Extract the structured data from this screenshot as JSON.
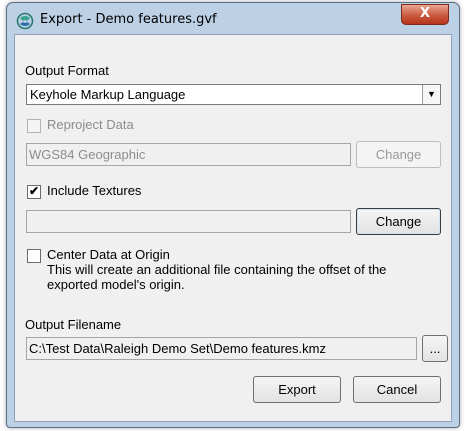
{
  "window": {
    "title": "Export - Demo features.gvf",
    "close_label": "X"
  },
  "output_format": {
    "label": "Output Format",
    "selected": "Keyhole Markup Language"
  },
  "reproject": {
    "label": "Reproject Data",
    "checked": false,
    "projection_value": "WGS84 Geographic",
    "change_label": "Change"
  },
  "textures": {
    "label": "Include Textures",
    "checked": true,
    "path_value": "",
    "change_label": "Change"
  },
  "center": {
    "label": "Center Data at Origin",
    "checked": false,
    "description_line1": "This will create an additional file containing the offset of the",
    "description_line2": "exported model's origin."
  },
  "output_filename": {
    "label": "Output Filename",
    "value": "C:\\Test Data\\Raleigh Demo Set\\Demo features.kmz",
    "browse_label": "..."
  },
  "actions": {
    "export_label": "Export",
    "cancel_label": "Cancel"
  }
}
